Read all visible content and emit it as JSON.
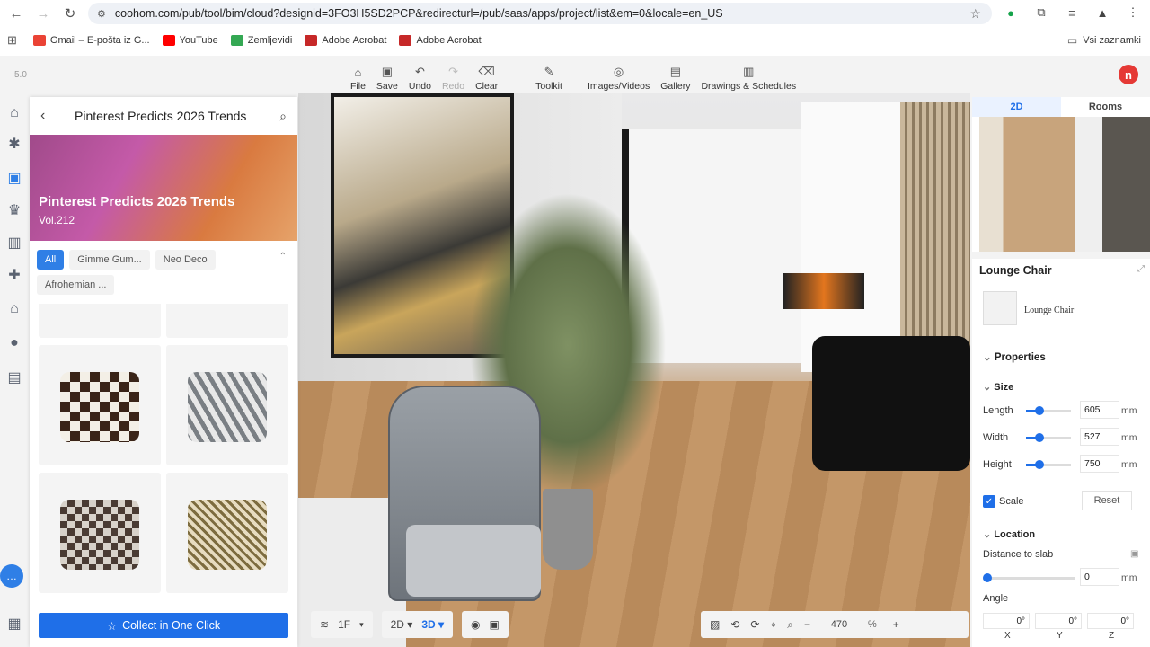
{
  "browser": {
    "url": "coohom.com/pub/tool/bim/cloud?designid=3FO3H5SD2PCP&redirecturl=/pub/saas/apps/project/list&em=0&locale=en_US",
    "bookmarks": [
      {
        "label": "Gmail – E-pošta iz G...",
        "color": "#ea4335"
      },
      {
        "label": "YouTube",
        "color": "#ff0000"
      },
      {
        "label": "Zemljevidi",
        "color": "#34a853"
      },
      {
        "label": "Adobe Acrobat",
        "color": "#c62828"
      },
      {
        "label": "Adobe Acrobat",
        "color": "#c62828"
      }
    ],
    "all_bookmarks": "Vsi zaznamki"
  },
  "app": {
    "version": "5.0",
    "toolbar": [
      {
        "label": "File",
        "icon": "file-icon"
      },
      {
        "label": "Save",
        "icon": "save-icon"
      },
      {
        "label": "Undo",
        "icon": "undo-icon"
      },
      {
        "label": "Redo",
        "icon": "redo-icon",
        "disabled": true
      },
      {
        "label": "Clear",
        "icon": "clear-icon"
      },
      {
        "label": "Toolkit",
        "icon": "toolkit-icon"
      },
      {
        "label": "Images/Videos",
        "icon": "camera-icon"
      },
      {
        "label": "Gallery",
        "icon": "gallery-icon"
      },
      {
        "label": "Drawings & Schedules",
        "icon": "drawings-icon"
      }
    ]
  },
  "left_panel": {
    "header_title": "Pinterest Predicts 2026 Trends",
    "banner_title": "Pinterest Predicts 2026 Trends",
    "banner_sub": "Vol.212",
    "filters": [
      "All",
      "Gimme Gum...",
      "Neo Deco",
      "Afrohemian ..."
    ],
    "active_filter": "All",
    "collect_button": "Collect in One Click"
  },
  "right_top": {
    "tabs": [
      "2D",
      "Rooms"
    ],
    "active_tab": "2D"
  },
  "properties": {
    "object_title": "Lounge Chair",
    "thumb_label": "Lounge Chair",
    "properties_heading": "Properties",
    "size_heading": "Size",
    "length_label": "Length",
    "length_value": "605",
    "width_label": "Width",
    "width_value": "527",
    "height_label": "Height",
    "height_value": "750",
    "unit": "mm",
    "scale_label": "Scale",
    "reset_label": "Reset",
    "location_heading": "Location",
    "distance_label": "Distance to slab",
    "distance_value": "0",
    "angle_label": "Angle",
    "angle_x": "0°",
    "angle_y": "0°",
    "angle_z": "0°",
    "axis_x": "X",
    "axis_y": "Y",
    "axis_z": "Z"
  },
  "bottom": {
    "floor": "1F",
    "view_2d": "2D",
    "view_3d": "3D",
    "zoom": "470",
    "zoom_unit": "%"
  }
}
